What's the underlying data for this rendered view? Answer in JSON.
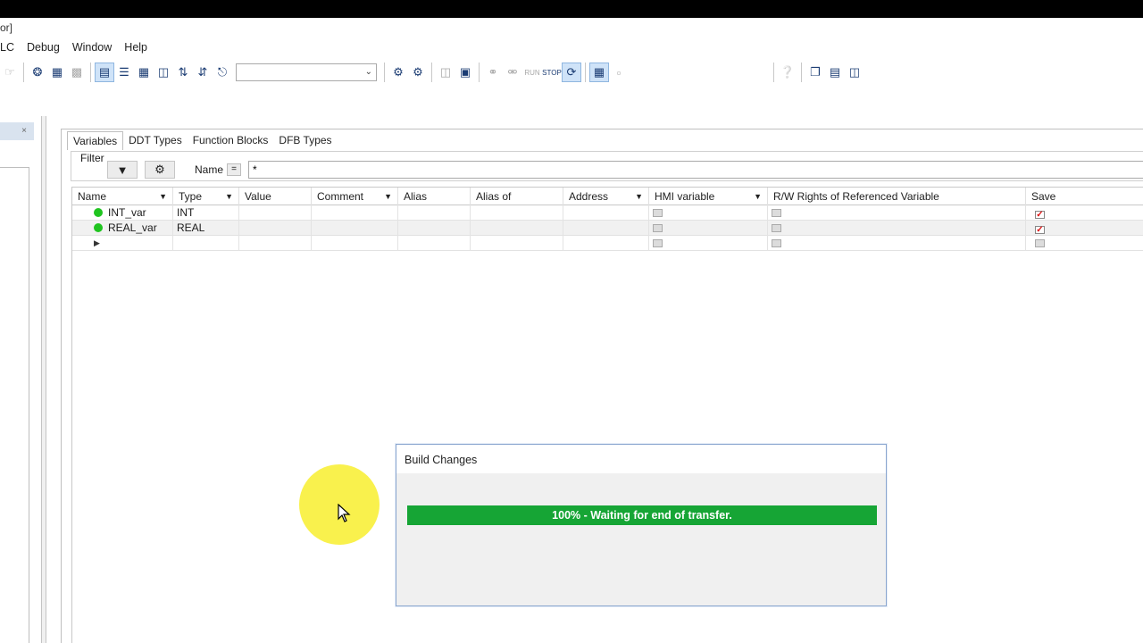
{
  "window": {
    "title_fragment": "or]"
  },
  "menu": {
    "items": [
      "LC",
      "Debug",
      "Window",
      "Help"
    ]
  },
  "toolbar": {
    "combo_value": "",
    "icons_group1": [
      "print-icon",
      "build-icon",
      "build-all-icon",
      "hand-icon"
    ],
    "icons_group2": [
      "view-list-icon",
      "view-tree-icon",
      "table-icon",
      "select-icon",
      "arrows-icon",
      "find-icon"
    ],
    "icons_group3": [
      "network-icon",
      "network2-icon",
      "panel-icon",
      "monitor-icon",
      "connect-icon",
      "disconnect-icon",
      "run-icon",
      "stop-icon",
      "refresh-icon",
      "animation-icon",
      "debug-icon"
    ],
    "icons_group4": [
      "help-pointer-icon"
    ],
    "icons_group5": [
      "cascade-icon",
      "tile-horizontal-icon",
      "tile-vertical-icon"
    ],
    "run_label": "RUN",
    "stop_label": "STOP"
  },
  "left_pane": {
    "close_glyph": "×"
  },
  "editor": {
    "tabs": [
      "Variables",
      "DDT Types",
      "Function Blocks",
      "DFB Types"
    ],
    "filter": {
      "label": "Filter",
      "name_label": "Name",
      "operator": "=",
      "value": "*"
    },
    "columns": [
      "Name",
      "Type",
      "Value",
      "Comment",
      "Alias",
      "Alias of",
      "Address",
      "HMI variable",
      "R/W Rights of Referenced Variable",
      "Save"
    ],
    "rows": [
      {
        "name": "INT_var",
        "type": "INT",
        "value": "",
        "comment": "",
        "alias": "",
        "alias_of": "",
        "address": "",
        "hmi": false,
        "rw": false,
        "save": true
      },
      {
        "name": "REAL_var",
        "type": "REAL",
        "value": "",
        "comment": "",
        "alias": "",
        "alias_of": "",
        "address": "",
        "hmi": false,
        "rw": false,
        "save": true
      },
      {
        "name": "",
        "type": "",
        "value": "",
        "comment": "",
        "alias": "",
        "alias_of": "",
        "address": "",
        "hmi": false,
        "rw": false,
        "save": false
      }
    ]
  },
  "dialog": {
    "title": "Build Changes",
    "progress_percent": 100,
    "progress_text": "100% - Waiting for end of transfer."
  },
  "colors": {
    "progress": "#16a535",
    "status_ok": "#1fc41f",
    "save_check": "#d11111"
  }
}
